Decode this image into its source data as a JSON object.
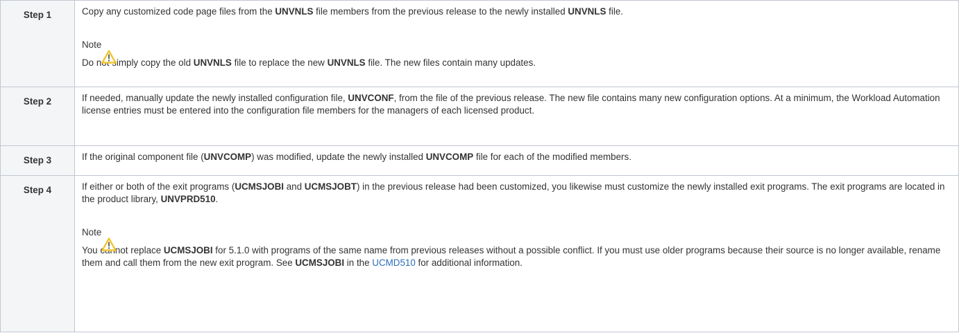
{
  "steps": [
    {
      "label": "Step 1",
      "p1_a": "Copy any customized code page files from the ",
      "p1_b": "UNVNLS",
      "p1_c": " file members from the previous release to the newly installed ",
      "p1_d": "UNVNLS",
      "p1_e": " file.",
      "note_title": "Note",
      "note_a": "Do not simply copy the old ",
      "note_b": "UNVNLS",
      "note_c": " file to replace the new ",
      "note_d": "UNVNLS",
      "note_e": " file. The new files contain many updates."
    },
    {
      "label": "Step 2",
      "p1_a": "If needed, manually update the newly installed configuration file, ",
      "p1_b": "UNVCONF",
      "p1_c": ", from the file of the previous release. The new file contains many new configuration options. At a minimum, the Workload Automation license entries must be entered into the configuration file members for the managers of each licensed product."
    },
    {
      "label": "Step 3",
      "p1_a": "If the original component file (",
      "p1_b": "UNVCOMP",
      "p1_c": ") was modified, update the newly installed ",
      "p1_d": "UNVCOMP",
      "p1_e": " file for each of the modified members."
    },
    {
      "label": "Step 4",
      "p1_a": "If either or both of the exit programs (",
      "p1_b": "UCMSJOBI",
      "p1_c": " and ",
      "p1_d": "UCMSJOBT",
      "p1_e": ") in the previous release had been customized, you likewise must customize the newly installed exit programs. The exit programs are located in the product library, ",
      "p1_f": "UNVPRD510",
      "p1_g": ".",
      "note_title": "Note",
      "note_a": "You cannot replace ",
      "note_b": "UCMSJOBI",
      "note_c": " for 5.1.0 with programs of the same name from previous releases without a possible conflict. If you must use older programs because their source is no longer available, rename them and call them from the new exit program. See ",
      "note_d": "UCMSJOBI",
      "note_e": " in the ",
      "note_link": "UCMD510",
      "note_f": " for additional information."
    }
  ],
  "icons": {
    "note_icon": "warning-triangle-icon",
    "icon_color": "#f5c518"
  },
  "colors": {
    "link": "#2a6ebb",
    "header_bg": "#f4f5f7",
    "border": "#c1c7d0"
  }
}
